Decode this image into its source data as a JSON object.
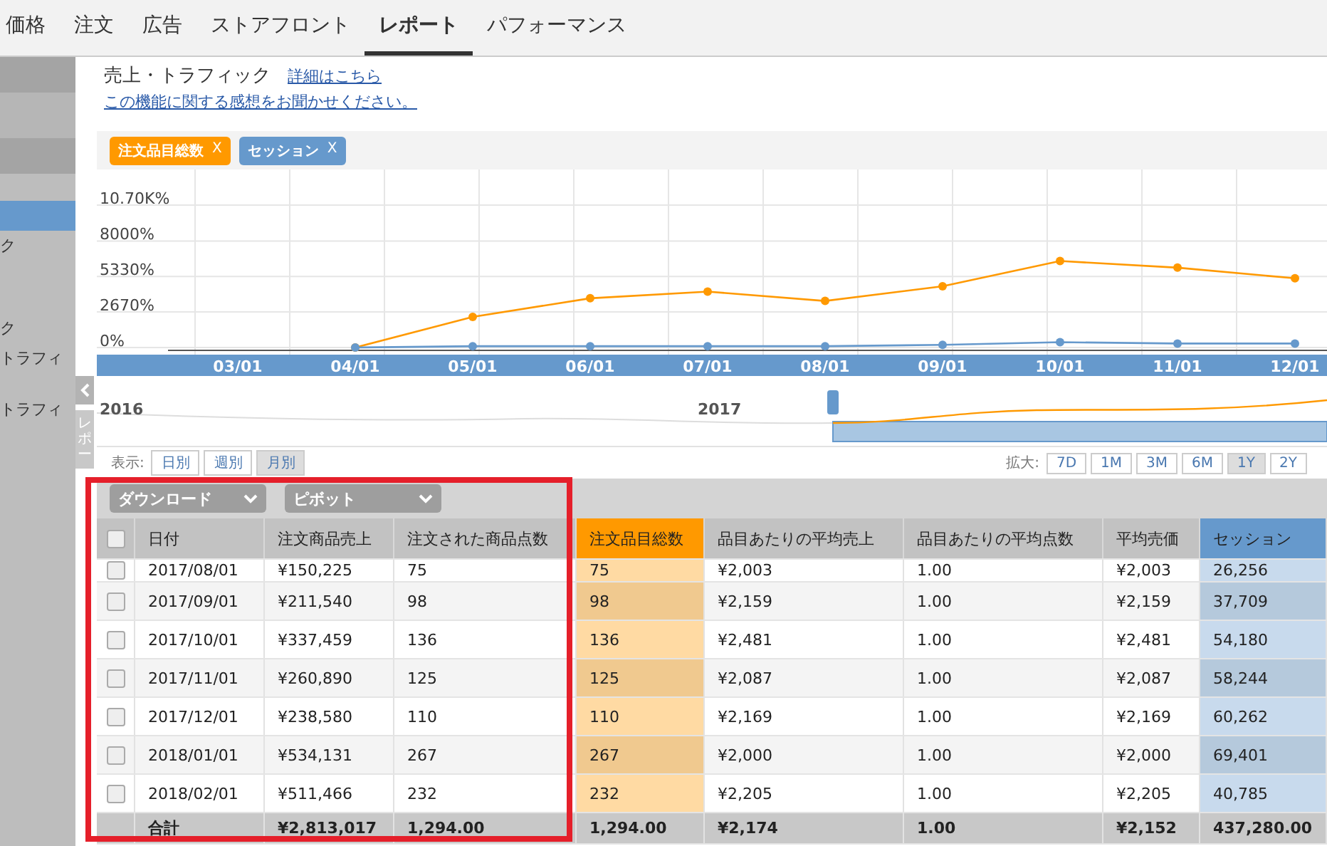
{
  "tabs": [
    {
      "label": "価格",
      "selected": false
    },
    {
      "label": "注文",
      "selected": false
    },
    {
      "label": "広告",
      "selected": false
    },
    {
      "label": "ストアフロント",
      "selected": false
    },
    {
      "label": "レポート",
      "selected": true
    },
    {
      "label": "パフォーマンス",
      "selected": false
    }
  ],
  "sidebar": {
    "items": [
      {
        "selected": true
      },
      {
        "label": "ク",
        "selected": false
      },
      {
        "label": "ク",
        "selected": false
      },
      {
        "label": "トラフィ",
        "selected": false
      },
      {
        "label": "トラフィ",
        "selected": false
      }
    ],
    "side_tab": "レポー"
  },
  "header": {
    "title": "売上・トラフィック",
    "details_link": "詳細はこちら",
    "feedback_link": "この機能に関する感想をお聞かせください。"
  },
  "chart_panel": {
    "chip_remove": [
      "X",
      "X"
    ],
    "chart_data": {
      "type": "line",
      "grid": true,
      "categories": [
        "03/01",
        "04/01",
        "05/01",
        "06/01",
        "07/01",
        "08/01",
        "09/01",
        "10/01",
        "11/01",
        "12/01"
      ],
      "series": [
        {
          "name": "注文品目総数",
          "color": "#ff9900",
          "marker": "circle",
          "values": [
            null,
            0,
            2300,
            3700,
            4200,
            3500,
            4600,
            6500,
            6000,
            5200
          ]
        },
        {
          "name": "セッション",
          "color": "#6699cc",
          "marker": "circle",
          "values": [
            null,
            0,
            100,
            100,
            100,
            100,
            200,
            400,
            300,
            300
          ]
        }
      ],
      "ylim": [
        0,
        13375
      ],
      "yticks": [
        {
          "value": 0,
          "label": "0%"
        },
        {
          "value": 2670,
          "label": "2670%"
        },
        {
          "value": 5330,
          "label": "5330%"
        },
        {
          "value": 8000,
          "label": "8000%"
        },
        {
          "value": 10700,
          "label": "10.70K%"
        }
      ]
    },
    "navigator": {
      "years": [
        "2016",
        "2017"
      ]
    }
  },
  "view": {
    "label": "表示:",
    "options": [
      {
        "label": "日別",
        "selected": false
      },
      {
        "label": "週別",
        "selected": false
      },
      {
        "label": "月別",
        "selected": true
      }
    ]
  },
  "zoom": {
    "label": "拡大:",
    "options": [
      {
        "label": "7D",
        "selected": false
      },
      {
        "label": "1M",
        "selected": false
      },
      {
        "label": "3M",
        "selected": false
      },
      {
        "label": "6M",
        "selected": false
      },
      {
        "label": "1Y",
        "selected": true
      },
      {
        "label": "2Y",
        "selected": false
      }
    ]
  },
  "toolbar": {
    "dropdowns": [
      "ダウンロード",
      "ピボット"
    ]
  },
  "table": {
    "header_checkbox": {
      "checked": false
    },
    "columns": [
      {
        "label": "日付"
      },
      {
        "label": "注文商品売上"
      },
      {
        "label": "注文された商品点数"
      },
      {
        "label": "注文品目総数",
        "color": "#ff9900"
      },
      {
        "label": "品目あたりの平均売上"
      },
      {
        "label": "品目あたりの平均点数"
      },
      {
        "label": "平均売価"
      },
      {
        "label": "セッション",
        "color": "#6699cc"
      }
    ],
    "rows": [
      {
        "checked": false,
        "cut_off": true,
        "cells": [
          "2017/08/01",
          "¥150,225",
          "75",
          "75",
          "¥2,003",
          "1.00",
          "¥2,003",
          "26,256"
        ]
      },
      {
        "checked": false,
        "cut_off": false,
        "cells": [
          "2017/09/01",
          "¥211,540",
          "98",
          "98",
          "¥2,159",
          "1.00",
          "¥2,159",
          "37,709"
        ]
      },
      {
        "checked": false,
        "cut_off": false,
        "cells": [
          "2017/10/01",
          "¥337,459",
          "136",
          "136",
          "¥2,481",
          "1.00",
          "¥2,481",
          "54,180"
        ]
      },
      {
        "checked": false,
        "cut_off": false,
        "cells": [
          "2017/11/01",
          "¥260,890",
          "125",
          "125",
          "¥2,087",
          "1.00",
          "¥2,087",
          "58,244"
        ]
      },
      {
        "checked": false,
        "cut_off": false,
        "cells": [
          "2017/12/01",
          "¥238,580",
          "110",
          "110",
          "¥2,169",
          "1.00",
          "¥2,169",
          "60,262"
        ]
      },
      {
        "checked": false,
        "cut_off": false,
        "cells": [
          "2018/01/01",
          "¥534,131",
          "267",
          "267",
          "¥2,000",
          "1.00",
          "¥2,000",
          "69,401"
        ]
      },
      {
        "checked": false,
        "cut_off": false,
        "cells": [
          "2018/02/01",
          "¥511,466",
          "232",
          "232",
          "¥2,205",
          "1.00",
          "¥2,205",
          "40,785"
        ]
      }
    ],
    "totals": [
      "合計",
      "¥2,813,017",
      "1,294.00",
      "1,294.00",
      "¥2,174",
      "1.00",
      "¥2,152",
      "437,280.00"
    ]
  }
}
